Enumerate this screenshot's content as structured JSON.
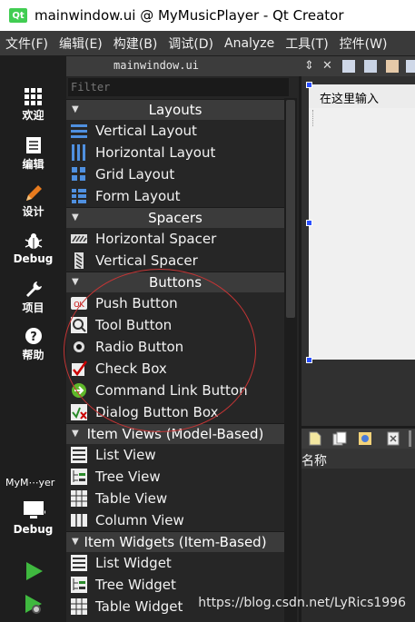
{
  "window": {
    "title": "mainwindow.ui @ MyMusicPlayer - Qt Creator",
    "app_icon": "Qt"
  },
  "menu": [
    "文件(F)",
    "编辑(E)",
    "构建(B)",
    "调试(D)",
    "Analyze",
    "工具(T)",
    "控件(W)"
  ],
  "modes": [
    {
      "label": "欢迎",
      "icon": "grid-icon"
    },
    {
      "label": "编辑",
      "icon": "document-icon"
    },
    {
      "label": "设计",
      "icon": "pencil-icon"
    },
    {
      "label": "Debug",
      "icon": "bug-icon"
    },
    {
      "label": "项目",
      "icon": "wrench-icon"
    },
    {
      "label": "帮助",
      "icon": "help-icon"
    }
  ],
  "target": {
    "project": "MyM⋯yer",
    "config": "Debug"
  },
  "editor": {
    "file": "mainwindow.ui",
    "filter_placeholder": "Filter"
  },
  "categories": {
    "layouts": "Layouts",
    "spacers": "Spacers",
    "buttons": "Buttons",
    "item_views": "Item Views (Model-Based)",
    "item_widgets": "Item Widgets (Item-Based)"
  },
  "items": {
    "vertical_layout": "Vertical Layout",
    "horizontal_layout": "Horizontal Layout",
    "grid_layout": "Grid Layout",
    "form_layout": "Form Layout",
    "horizontal_spacer": "Horizontal Spacer",
    "vertical_spacer": "Vertical Spacer",
    "push_button": "Push Button",
    "tool_button": "Tool Button",
    "radio_button": "Radio Button",
    "check_box": "Check Box",
    "command_link_button": "Command Link Button",
    "dialog_button_box": "Dialog Button Box",
    "list_view": "List View",
    "tree_view": "Tree View",
    "table_view": "Table View",
    "column_view": "Column View",
    "list_widget": "List Widget",
    "tree_widget": "Tree Widget",
    "table_widget": "Table Widget"
  },
  "form": {
    "menu_placeholder": "在这里输入"
  },
  "object_inspector": {
    "header": "名称"
  },
  "watermark": "https://blog.csdn.net/LyRics1996",
  "colors": {
    "accent_green": "#41cd52",
    "annotation_red": "#c43535",
    "selection_handle": "#2a4fff"
  }
}
